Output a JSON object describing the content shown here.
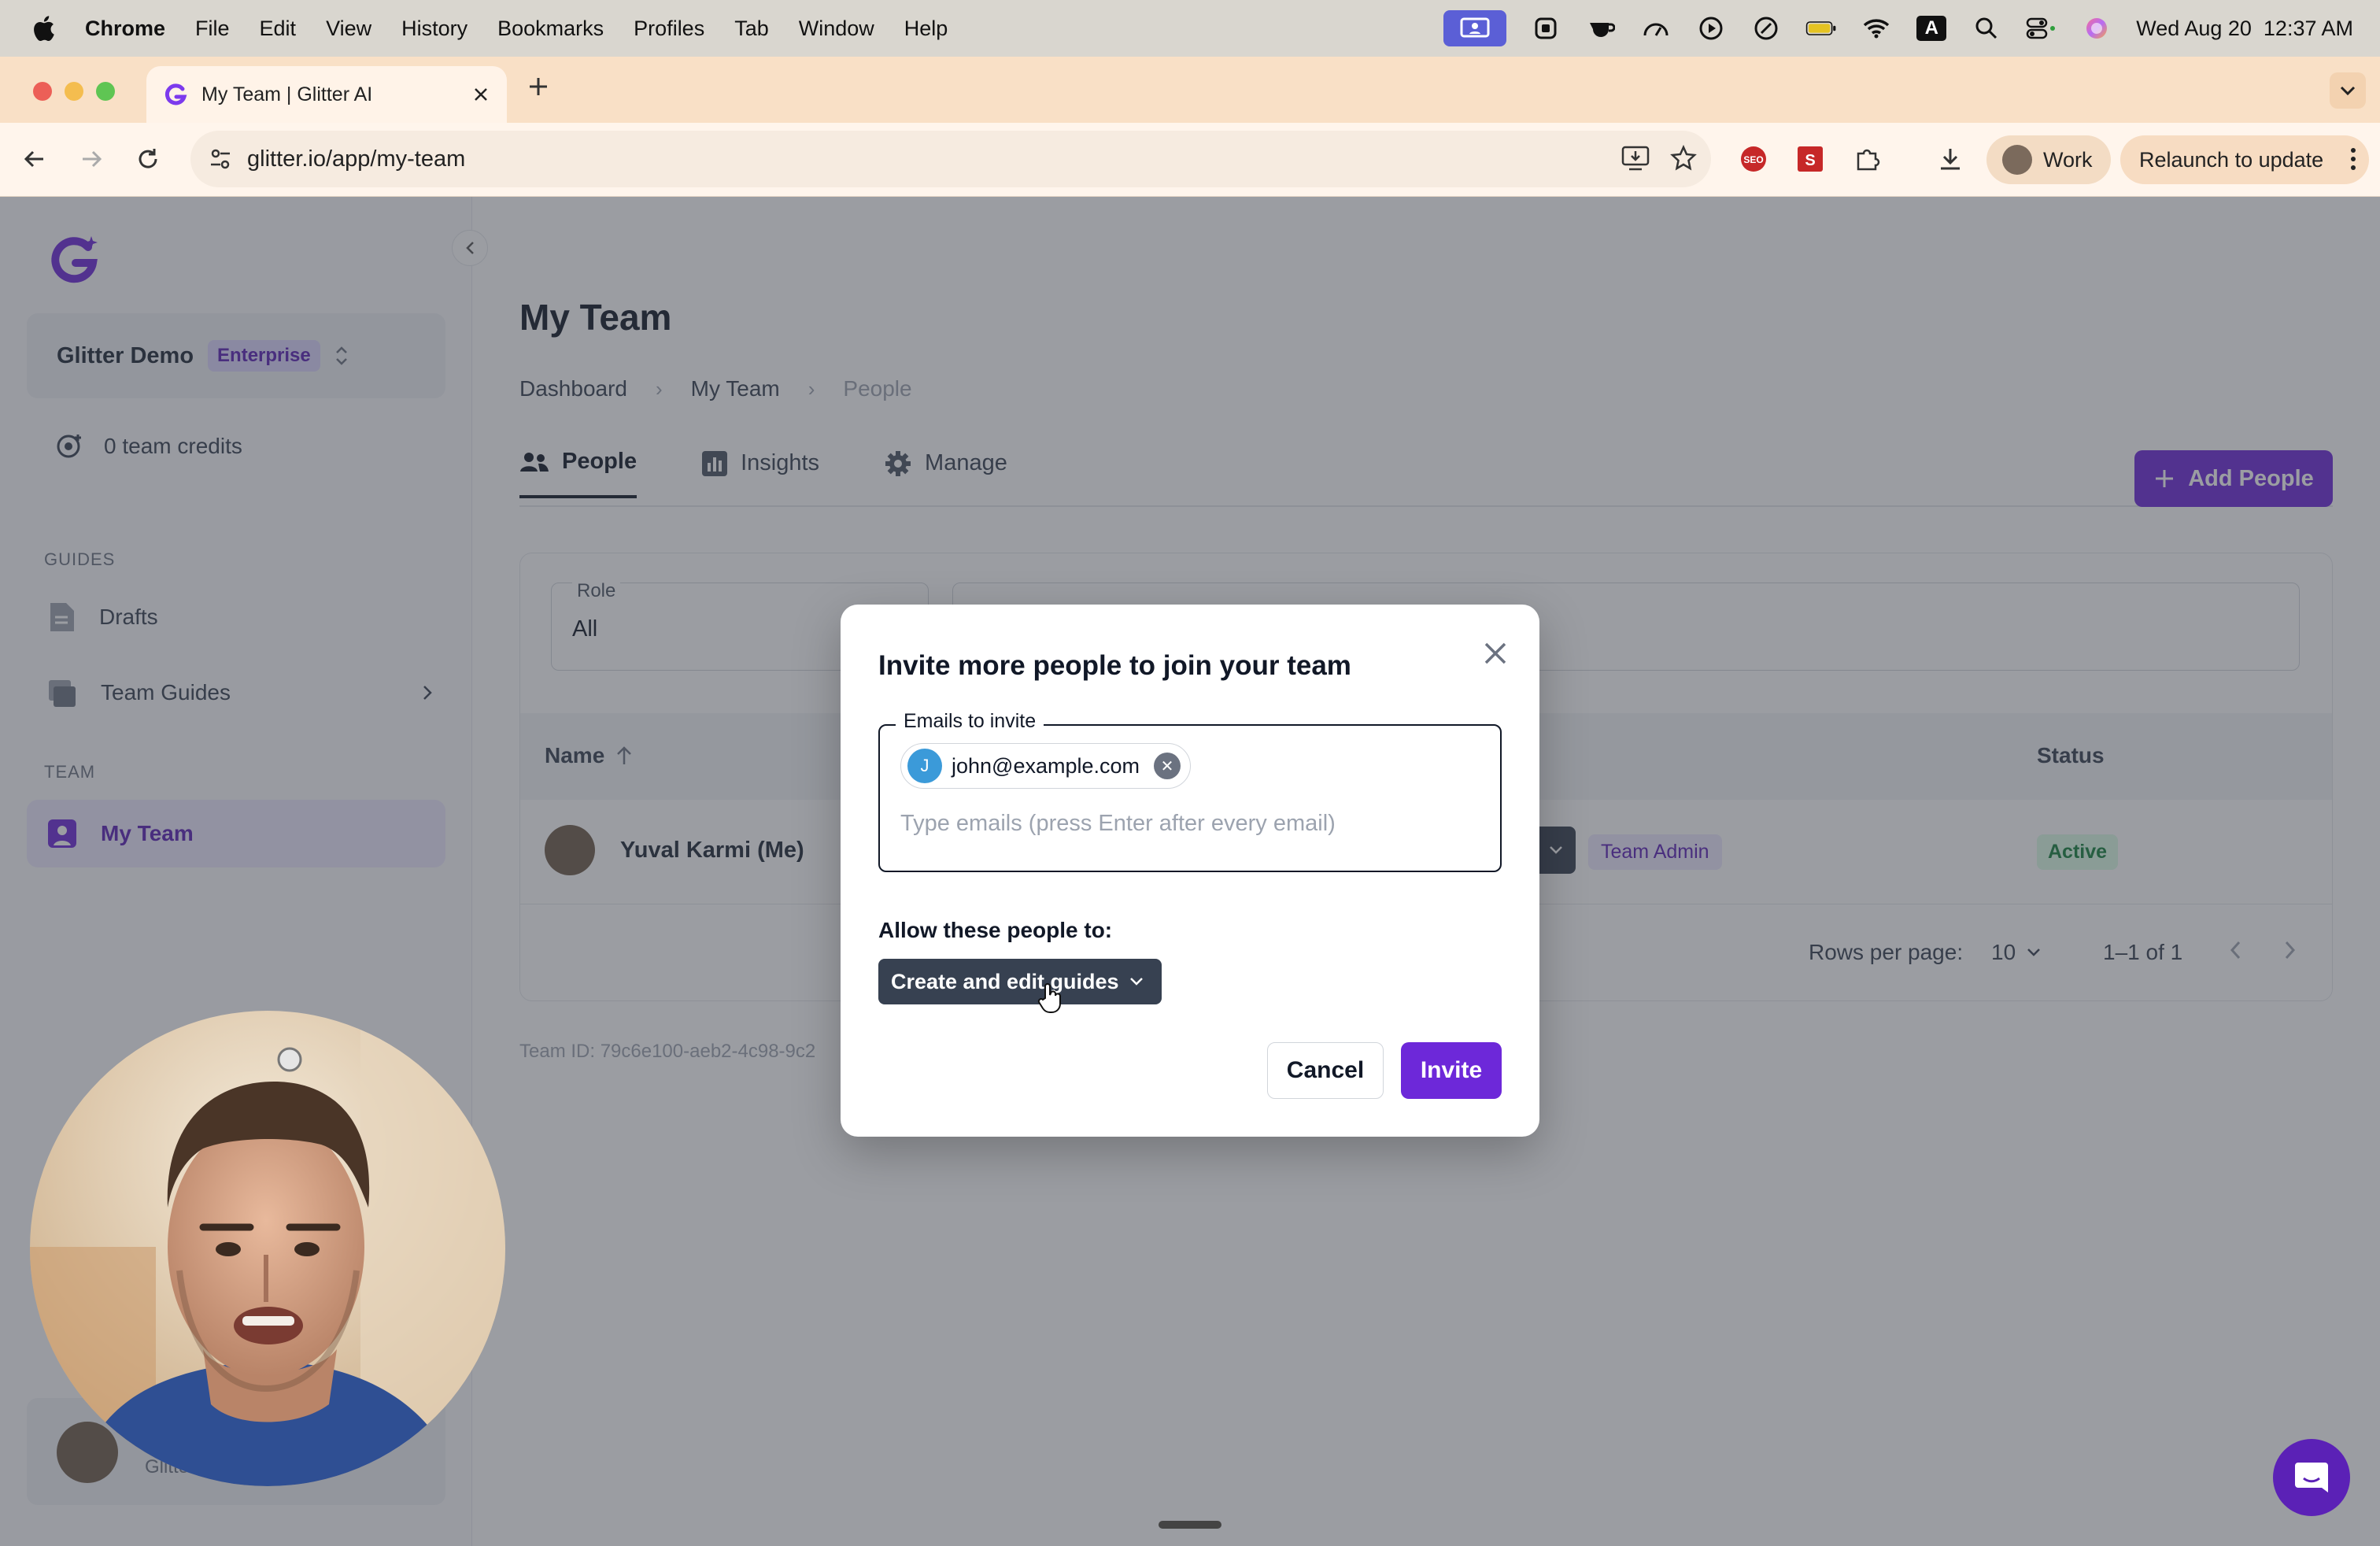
{
  "menubar": {
    "app_name": "Chrome",
    "items": [
      "File",
      "Edit",
      "View",
      "History",
      "Bookmarks",
      "Profiles",
      "Tab",
      "Window",
      "Help"
    ],
    "datetime": "Wed Aug 20  12:37 AM",
    "input_source": "A"
  },
  "browser": {
    "tab_title": "My Team | Glitter AI",
    "url": "glitter.io/app/my-team",
    "profile_label": "Work",
    "relaunch_label": "Relaunch to update",
    "accent": "#f9e0c6"
  },
  "sidebar": {
    "workspace_name": "Glitter Demo",
    "plan_badge": "Enterprise",
    "credits": "0 team credits",
    "guides_heading": "GUIDES",
    "guides_items": [
      "Drafts",
      "Team Guides"
    ],
    "team_heading": "TEAM",
    "team_items": [
      "My Team"
    ],
    "footer_user_partial": "Glitter"
  },
  "page": {
    "title": "My Team",
    "breadcrumb": [
      "Dashboard",
      "My Team",
      "People"
    ],
    "tabs": [
      "People",
      "Insights",
      "Manage"
    ],
    "add_people_label": "Add People",
    "filter": {
      "label": "Role",
      "value": "All"
    },
    "table": {
      "headers": {
        "name": "Name",
        "status": "Status"
      },
      "rows": [
        {
          "name": "Yuval Karmi (Me)",
          "role": "Team Admin",
          "status": "Active"
        }
      ],
      "rows_per_page_label": "Rows per page:",
      "rows_per_page_value": "10",
      "range": "1–1 of 1"
    },
    "team_id_partial": "Team ID: 79c6e100-aeb2-4c98-9c2"
  },
  "modal": {
    "title": "Invite more people to join your team",
    "emails_label": "Emails to invite",
    "email_chip": {
      "initial": "J",
      "email": "john@example.com"
    },
    "input_placeholder": "Type emails (press Enter after every email)",
    "allow_label": "Allow these people to:",
    "permission_value": "Create and edit guides",
    "cancel_label": "Cancel",
    "invite_label": "Invite"
  },
  "colors": {
    "primary": "#6d28d9",
    "dark_button": "#374151",
    "active_green": "#15803d"
  }
}
